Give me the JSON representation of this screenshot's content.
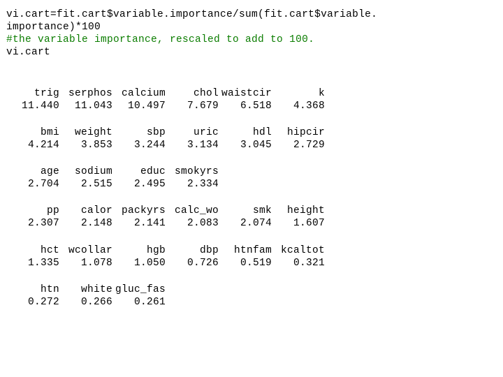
{
  "code": {
    "l1": "vi.cart=fit.cart$variable.importance/sum(fit.cart$variable.",
    "l2": "importance)*100",
    "comment": "#the variable importance, rescaled to add to 100.",
    "l3": "vi.cart"
  },
  "rows": [
    {
      "sep": true
    },
    {
      "cells": [
        "trig",
        "serphos",
        "calcium",
        "chol",
        "waistcir",
        "k"
      ]
    },
    {
      "cells": [
        "11.440",
        "11.043",
        "10.497",
        "7.679",
        "6.518",
        "4.368"
      ]
    },
    {
      "sep": true
    },
    {
      "cells": [
        "bmi",
        "weight",
        "sbp",
        "uric",
        "hdl",
        "hipcir"
      ]
    },
    {
      "cells": [
        "4.214",
        "3.853",
        "3.244",
        "3.134",
        "3.045",
        "2.729"
      ]
    },
    {
      "sep": true
    },
    {
      "cells": [
        "age",
        "sodium",
        "educ",
        "smokyrs",
        "",
        ""
      ]
    },
    {
      "cells": [
        "2.704",
        "2.515",
        "2.495",
        "2.334",
        "",
        ""
      ]
    },
    {
      "sep": true
    },
    {
      "cells": [
        "pp",
        "calor",
        "packyrs",
        "calc_wo",
        "smk",
        "height"
      ]
    },
    {
      "cells": [
        "2.307",
        "2.148",
        "2.141",
        "2.083",
        "2.074",
        "1.607"
      ]
    },
    {
      "sep": true
    },
    {
      "cells": [
        "hct",
        "wcollar",
        "hgb",
        "dbp",
        "htnfam",
        "kcaltot"
      ]
    },
    {
      "cells": [
        "1.335",
        "1.078",
        "1.050",
        "0.726",
        "0.519",
        "0.321"
      ]
    },
    {
      "sep": true
    },
    {
      "cells": [
        "htn",
        "white",
        "gluc_fas",
        "",
        "",
        ""
      ]
    },
    {
      "cells": [
        "0.272",
        "0.266",
        "0.261",
        "",
        "",
        ""
      ]
    }
  ]
}
